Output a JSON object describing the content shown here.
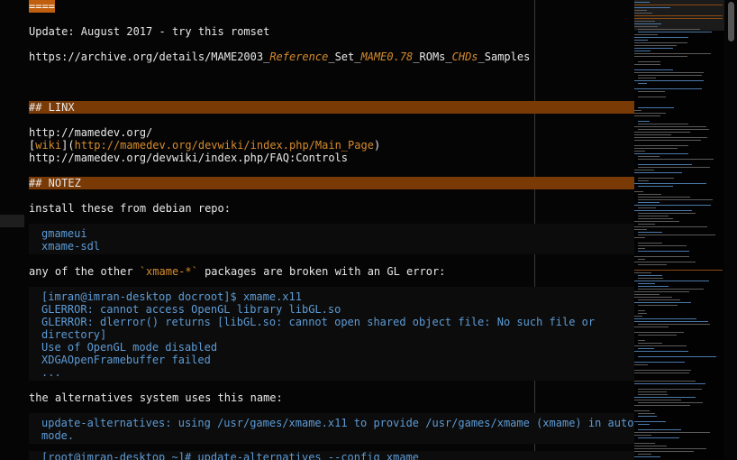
{
  "colors": {
    "background": "#000000",
    "heading_bar": "#7a3a06",
    "accent_orange": "#d58b2e",
    "code_blue": "#5d9bd6",
    "text": "#e8e8e8"
  },
  "editor": {
    "top_fragment": "====",
    "update_line": "Update: August 2017 - try this romset",
    "archive_url": {
      "p1": "https://archive.org/details/MAME2003_",
      "p2": "Reference",
      "p3": "_Set_",
      "p4": "MAME0.78",
      "p5": "_ROMs_",
      "p6": "CHDs",
      "p7": "_Samples"
    },
    "heading_linx": "## LINX",
    "linx_url1": "http://mamedev.org/",
    "wiki_link": {
      "open": "[",
      "word": "wiki",
      "mid": "](",
      "url": "http://mamedev.org/devwiki/index.php/Main_Page",
      "close": ")"
    },
    "linx_url3": "http://mamedev.org/devwiki/index.php/FAQ:Controls",
    "heading_notez": "## NOTEZ",
    "install_line": "install these from debian repo:",
    "packages": [
      "gmameui",
      "xmame-sdl"
    ],
    "other_line": {
      "p1": "any of the other ",
      "code": "`xmame-*`",
      "p2": " packages are broken with an GL error:"
    },
    "error_block": [
      "[imran@imran-desktop docroot]$ xmame.x11",
      "GLERROR: cannot access OpenGL library libGL.so",
      "GLERROR: dlerror() returns [libGL.so: cannot open shared object file: No such file or",
      "directory]",
      "Use of OpenGL mode disabled",
      "XDGAOpenFramebuffer failed",
      "..."
    ],
    "alternatives_line": "the alternatives system uses this name:",
    "alternatives_block": [
      "update-alternatives: using /usr/games/xmame.x11 to provide /usr/games/xmame (xmame) in auto",
      "mode."
    ],
    "last_partial": "[root@imran-desktop ~]# update-alternatives --config xmame"
  }
}
